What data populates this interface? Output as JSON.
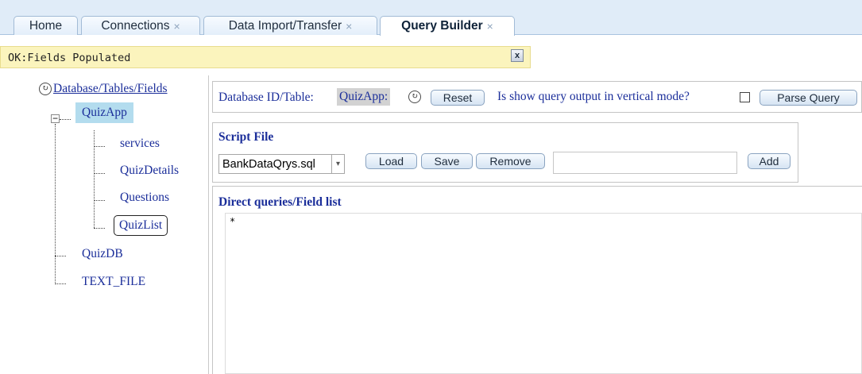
{
  "tabs": [
    {
      "label": "Home",
      "closable": false,
      "active": false
    },
    {
      "label": "Connections",
      "closable": true,
      "active": false
    },
    {
      "label": "Data Import/Transfer",
      "closable": true,
      "active": false
    },
    {
      "label": "Query Builder",
      "closable": true,
      "active": true
    }
  ],
  "tab_close_glyph": "×",
  "status": {
    "message": "OK:Fields Populated",
    "close_glyph": "x"
  },
  "tree": {
    "root": "Database/Tables/Fields",
    "expander_glyph": "−",
    "databases": [
      {
        "name": "QuizApp",
        "expanded": true,
        "selected": true,
        "tables": [
          "services",
          "QuizDetails",
          "Questions",
          "QuizList"
        ],
        "focused_table": "QuizList"
      },
      {
        "name": "QuizDB"
      },
      {
        "name": "TEXT_FILE"
      }
    ]
  },
  "query": {
    "db_label": "Database ID/Table:",
    "db_value": "QuizApp:",
    "reset_label": "Reset",
    "vertical_mode_label": "Is show query output in vertical mode?",
    "vertical_mode_checked": false,
    "parse_label": "Parse Query"
  },
  "script_file": {
    "title": "Script File",
    "selected": "BankDataQrys.sql",
    "load_label": "Load",
    "save_label": "Save",
    "remove_label": "Remove",
    "name_value": "",
    "add_label": "Add"
  },
  "direct_queries": {
    "title": "Direct queries/Field list",
    "content": "*"
  },
  "icons": {
    "refresh": "refresh-icon",
    "dropdown": "chevron-down-icon",
    "close": "close-icon"
  },
  "colors": {
    "link": "#1b2e9a",
    "tab_bar": "#e0ecf8",
    "status_bg": "#fbf4bd",
    "selected_bg": "#b3dcee"
  }
}
